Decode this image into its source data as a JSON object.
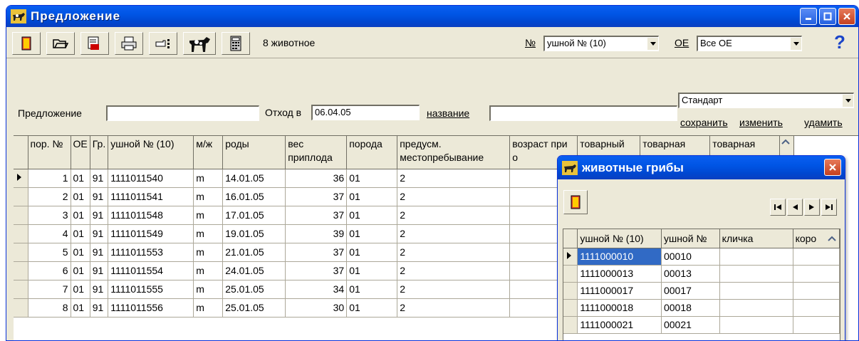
{
  "window": {
    "title": "Предложение"
  },
  "toolbar": {
    "count_text": "8 животное",
    "no_label": "№",
    "no_value": "ушной № (10)",
    "oe_label": "ОЕ",
    "oe_value": "Все ОЕ",
    "help_symbol": "?"
  },
  "form": {
    "offer_label": "Предложение",
    "offer_value": "",
    "departure_label": "Отход в",
    "departure_value": "06.04.05",
    "name_label": "название",
    "name_value": "",
    "template_value": "Стандарт",
    "save_label": "сохранить",
    "change_label": "изменить",
    "delete_label": "удамить"
  },
  "table": {
    "headers": [
      "пор. №",
      "ОЕ",
      "Гр.",
      "ушной № (10)",
      "м/ж",
      "роды",
      "вес приплода",
      "порода",
      "предусм. местопребывание",
      "возраст при о",
      "товарный",
      "товарная цена",
      "товарная цена"
    ],
    "rows": [
      [
        "1",
        "01",
        "91",
        "1111011540",
        "m",
        "14.01.05",
        "36",
        "01",
        "2"
      ],
      [
        "2",
        "01",
        "91",
        "1111011541",
        "m",
        "16.01.05",
        "37",
        "01",
        "2"
      ],
      [
        "3",
        "01",
        "91",
        "1111011548",
        "m",
        "17.01.05",
        "37",
        "01",
        "2"
      ],
      [
        "4",
        "01",
        "91",
        "1111011549",
        "m",
        "19.01.05",
        "39",
        "01",
        "2"
      ],
      [
        "5",
        "01",
        "91",
        "1111011553",
        "m",
        "21.01.05",
        "37",
        "01",
        "2"
      ],
      [
        "6",
        "01",
        "91",
        "1111011554",
        "m",
        "24.01.05",
        "37",
        "01",
        "2"
      ],
      [
        "7",
        "01",
        "91",
        "1111011555",
        "m",
        "25.01.05",
        "34",
        "01",
        "2"
      ],
      [
        "8",
        "01",
        "91",
        "1111011556",
        "m",
        "25.01.05",
        "30",
        "01",
        "2"
      ]
    ]
  },
  "popup": {
    "title": "животные грибы",
    "headers": [
      "ушной № (10)",
      "ушной №",
      "кличка",
      "коро"
    ],
    "rows": [
      [
        "1111000010",
        "00010",
        "",
        ""
      ],
      [
        "1111000013",
        "00013",
        "",
        ""
      ],
      [
        "1111000017",
        "00017",
        "",
        ""
      ],
      [
        "1111000018",
        "00018",
        "",
        ""
      ],
      [
        "1111000021",
        "00021",
        "",
        ""
      ]
    ]
  },
  "colors": {
    "selection": "#316ac5",
    "titlebar": "#0055e5",
    "face": "#ece9d8"
  }
}
